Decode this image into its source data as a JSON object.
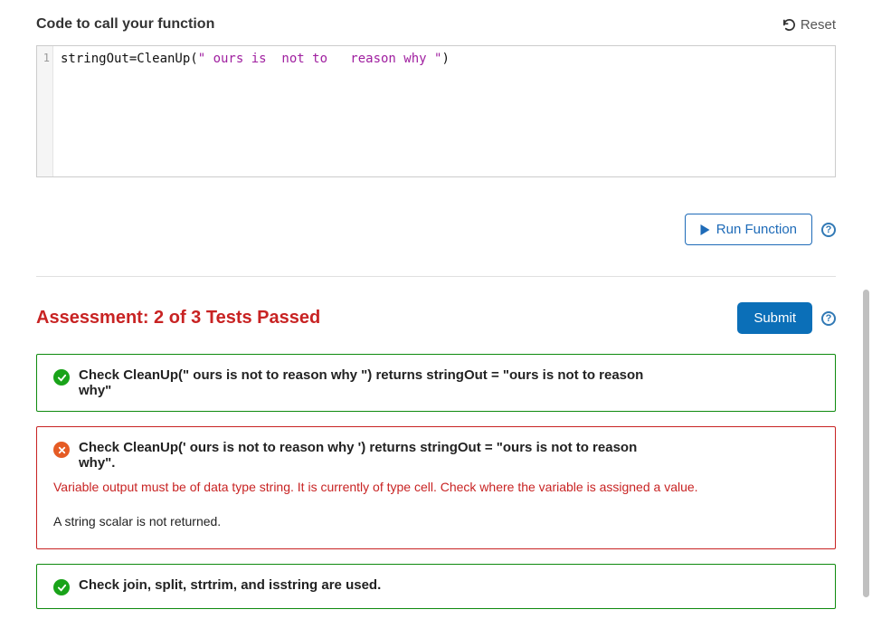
{
  "header": {
    "title": "Code to call your function",
    "reset_label": "Reset"
  },
  "editor": {
    "line_number": "1",
    "code_prefix": "stringOut=CleanUp(",
    "code_string": "\" ours is  not to   reason why \"",
    "code_suffix": ")"
  },
  "run": {
    "label": "Run Function",
    "help": "?"
  },
  "assessment": {
    "title": "Assessment: 2 of 3 Tests Passed",
    "submit_label": "Submit",
    "help": "?"
  },
  "tests": [
    {
      "status": "pass",
      "title": "Check CleanUp(\" ours is not to reason why \") returns stringOut = \"ours is not to reason why\""
    },
    {
      "status": "fail",
      "title": "Check CleanUp(' ours is not to reason why ') returns stringOut = \"ours is not to reason why\".",
      "error": "Variable output must be of data type string. It is currently of type cell. Check where the variable is assigned a value.",
      "detail": "A string scalar is not returned."
    },
    {
      "status": "pass",
      "title": "Check join, split, strtrim, and isstring are used."
    }
  ]
}
